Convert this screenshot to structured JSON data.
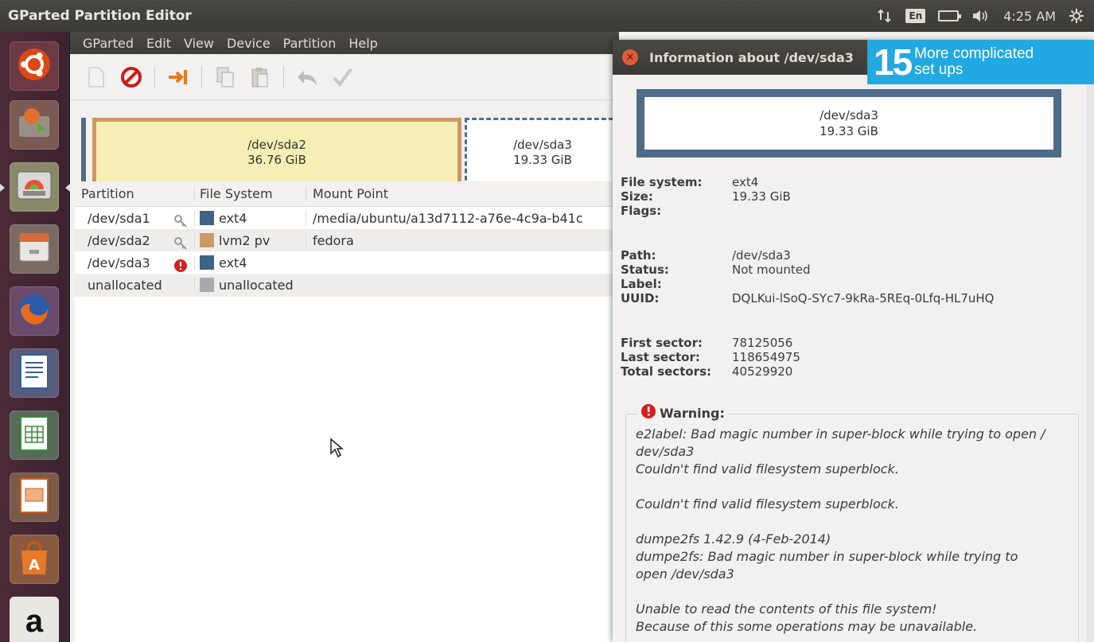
{
  "top_panel": {
    "title": "GParted Partition Editor",
    "keyboard_layout": "En",
    "time": "4:25 AM",
    "icons": [
      "network-icon",
      "keyboard-icon",
      "battery-icon",
      "volume-icon",
      "gear-icon"
    ]
  },
  "launcher": {
    "items": [
      {
        "name": "dash-home",
        "icon": "ubuntu-logo-icon"
      },
      {
        "name": "installer",
        "icon": "installer-icon"
      },
      {
        "name": "gparted",
        "icon": "gparted-icon",
        "active": true
      },
      {
        "name": "files",
        "icon": "files-icon"
      },
      {
        "name": "firefox",
        "icon": "firefox-icon"
      },
      {
        "name": "writer",
        "icon": "libreoffice-writer-icon"
      },
      {
        "name": "calc",
        "icon": "libreoffice-calc-icon"
      },
      {
        "name": "impress",
        "icon": "libreoffice-impress-icon"
      },
      {
        "name": "software-center",
        "icon": "software-center-icon"
      },
      {
        "name": "amazon",
        "icon": "amazon-icon",
        "label": "a"
      }
    ]
  },
  "gparted": {
    "menu": [
      "GParted",
      "Edit",
      "View",
      "Device",
      "Partition",
      "Help"
    ],
    "disk_graphic": [
      {
        "name": "/dev/sda2",
        "size": "36.76 GiB"
      },
      {
        "name": "/dev/sda3",
        "size": "19.33 GiB"
      }
    ],
    "table": {
      "headers": [
        "Partition",
        "File System",
        "Mount Point"
      ],
      "rows": [
        {
          "partition": "/dev/sda1",
          "fs": "ext4",
          "fs_color": "#3e6387",
          "mount": "/media/ubuntu/a13d7112-a76e-4c9a-b41c",
          "icon": "key-icon"
        },
        {
          "partition": "/dev/sda2",
          "fs": "lvm2 pv",
          "fs_color": "#cc9966",
          "mount": "fedora",
          "icon": "key-icon"
        },
        {
          "partition": "/dev/sda3",
          "fs": "ext4",
          "fs_color": "#3e6387",
          "mount": "",
          "icon": "error-icon"
        },
        {
          "partition": "unallocated",
          "fs": "unallocated",
          "fs_color": "#a9a9a9",
          "mount": "",
          "icon": ""
        }
      ]
    }
  },
  "dialog": {
    "title": "Information about /dev/sda3",
    "vis_name": "/dev/sda3",
    "vis_size": "19.33 GiB",
    "fs_label": "File system:",
    "fs_value": "ext4",
    "size_label": "Size:",
    "size_value": "19.33 GiB",
    "flags_label": "Flags:",
    "path_label": "Path:",
    "path_value": "/dev/sda3",
    "status_label": "Status:",
    "status_value": "Not mounted",
    "label_label": "Label:",
    "uuid_label": "UUID:",
    "uuid_value": "DQLKui-lSoQ-SYc7-9kRa-5REq-0Lfq-HL7uHQ",
    "first_label": "First sector:",
    "first_value": "78125056",
    "last_label": "Last sector:",
    "last_value": "118654975",
    "total_label": "Total sectors:",
    "total_value": "40529920",
    "warning_label": "Warning:",
    "warning_lines": [
      "e2label: Bad magic number in super-block while trying to open /",
      "dev/sda3",
      "Couldn't find valid filesystem superblock.",
      "",
      "Couldn't find valid filesystem superblock.",
      "",
      "dumpe2fs 1.42.9 (4-Feb-2014)",
      "dumpe2fs: Bad magic number in super-block while trying to",
      "open /dev/sda3",
      "",
      "Unable to read the contents of this file system!",
      "Because of this some operations may be unavailable."
    ]
  },
  "badge": {
    "number": "15",
    "text_line1": "More complicated",
    "text_line2": "set ups",
    "color": "#23a9e1"
  }
}
